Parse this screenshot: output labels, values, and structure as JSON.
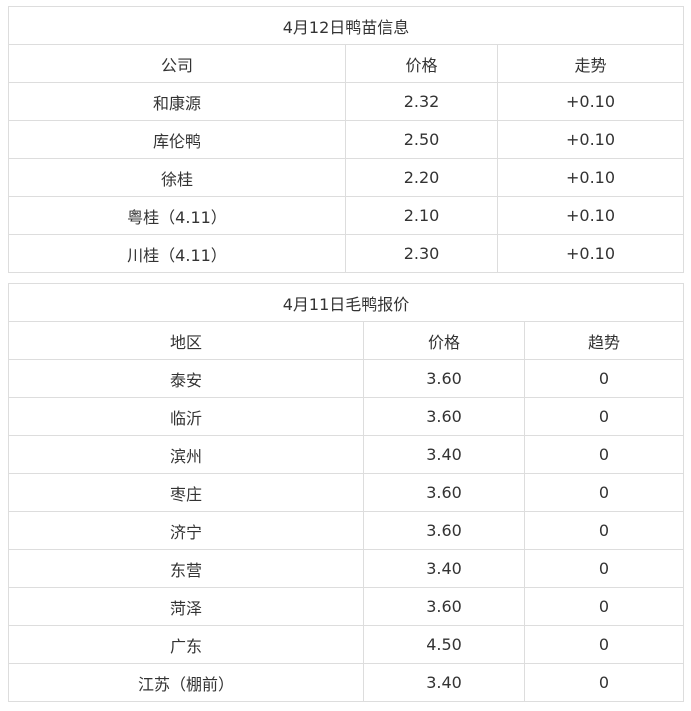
{
  "duckling_table": {
    "title": "4月12日鸭苗信息",
    "headers": [
      "公司",
      "价格",
      "走势"
    ],
    "rows": [
      [
        "和康源",
        "2.32",
        "+0.10"
      ],
      [
        "库伦鸭",
        "2.50",
        "+0.10"
      ],
      [
        "徐桂",
        "2.20",
        "+0.10"
      ],
      [
        "粤桂（4.11）",
        "2.10",
        "+0.10"
      ],
      [
        "川桂（4.11）",
        "2.30",
        "+0.10"
      ]
    ]
  },
  "duck_table": {
    "title": "4月11日毛鸭报价",
    "headers": [
      "地区",
      "价格",
      "趋势"
    ],
    "rows": [
      [
        "泰安",
        "3.60",
        "0"
      ],
      [
        "临沂",
        "3.60",
        "0"
      ],
      [
        "滨州",
        "3.40",
        "0"
      ],
      [
        "枣庄",
        "3.60",
        "0"
      ],
      [
        "济宁",
        "3.60",
        "0"
      ],
      [
        "东营",
        "3.40",
        "0"
      ],
      [
        "菏泽",
        "3.60",
        "0"
      ],
      [
        "广东",
        "4.50",
        "0"
      ],
      [
        "江苏（棚前）",
        "3.40",
        "0"
      ]
    ]
  },
  "colors": {
    "border": "#dddddd",
    "text": "#333333"
  }
}
